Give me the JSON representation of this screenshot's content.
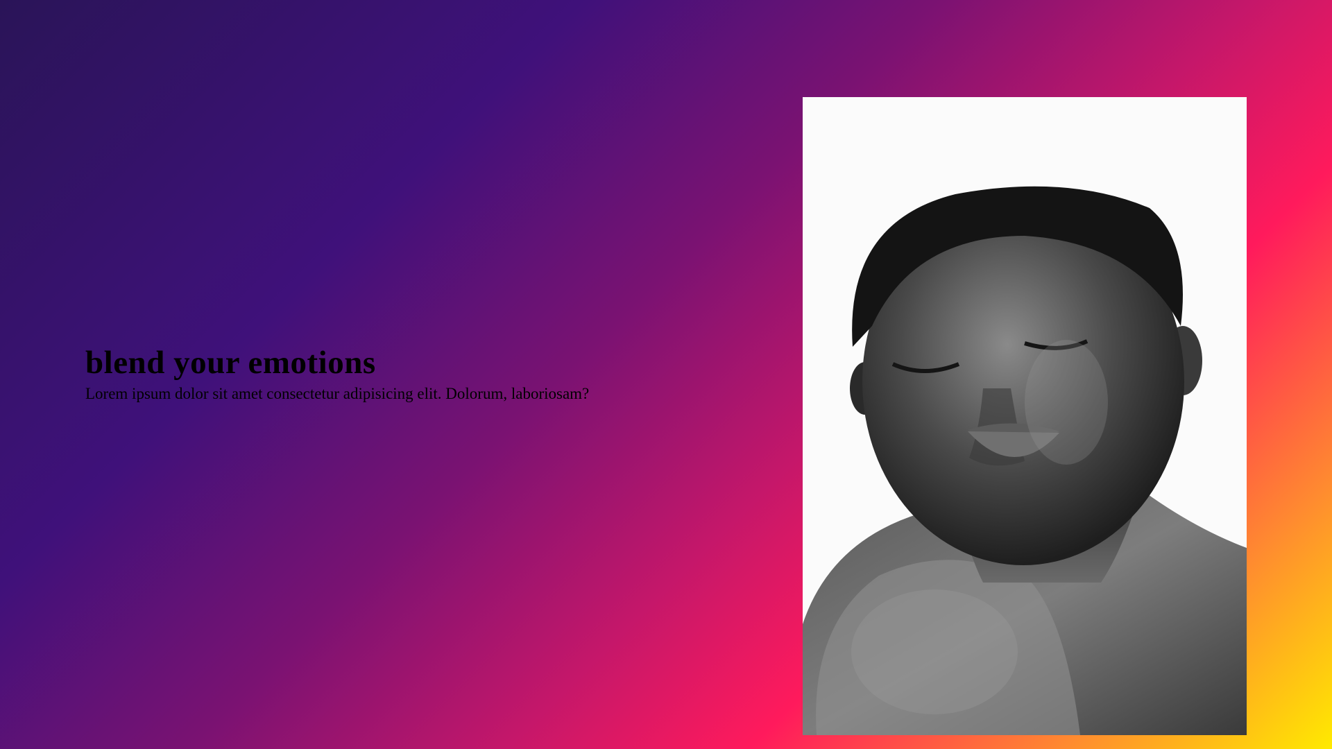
{
  "hero": {
    "title": "blend your emotions",
    "subtitle": "Lorem ipsum dolor sit amet consectetur adipisicing elit. Dolorum, laboriosam?"
  },
  "portrait": {
    "description_icon": "portrait-photo"
  },
  "colors": {
    "gradient_start": "#2a1458",
    "gradient_mid": "#ff1a5c",
    "gradient_end": "#ffea00"
  }
}
